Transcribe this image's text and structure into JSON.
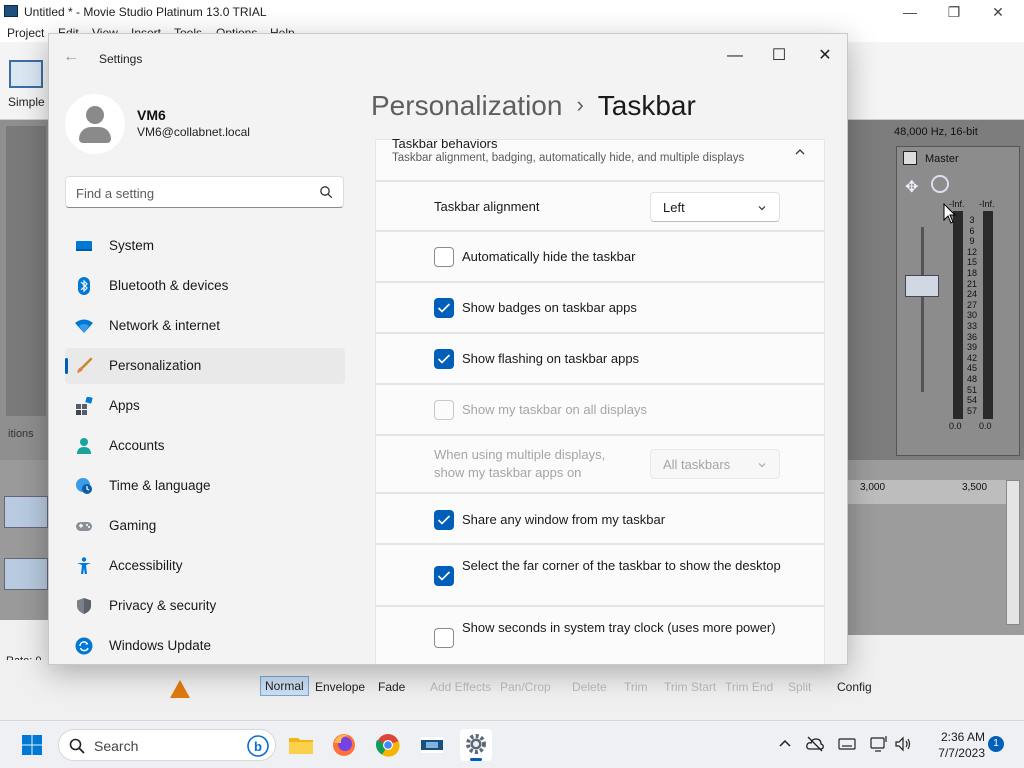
{
  "background_app": {
    "title": "Untitled * - Movie Studio Platinum 13.0 TRIAL",
    "menu": [
      "Project",
      "Edit",
      "View",
      "Insert",
      "Tools",
      "Options",
      "Help"
    ],
    "simple_label": "Simple",
    "left_panel_label": "itions",
    "rate_label": "Rate: 0.",
    "audio_format": "48,000 Hz, 16-bit",
    "master_label": "Master",
    "meter_top_left": "-Inf.",
    "meter_top_right": "-Inf.",
    "meter_scale": [
      "3",
      "6",
      "9",
      "12",
      "15",
      "18",
      "21",
      "24",
      "27",
      "30",
      "33",
      "36",
      "39",
      "42",
      "45",
      "48",
      "51",
      "54",
      "57"
    ],
    "meter_bottom_left": "0.0",
    "meter_bottom_right": "0.0",
    "ruler_ticks": [
      "3,000",
      "3,500"
    ],
    "tools": {
      "normal": "Normal",
      "envelope": "Envelope",
      "fade": "Fade",
      "add_effects": "Add Effects",
      "pan_crop": "Pan/Crop",
      "delete": "Delete",
      "trim": "Trim",
      "trim_start": "Trim Start",
      "trim_end": "Trim End",
      "split": "Split",
      "config": "Config"
    }
  },
  "settings": {
    "window_title": "Settings",
    "profile": {
      "name": "VM6",
      "email": "VM6@collabnet.local"
    },
    "search_placeholder": "Find a setting",
    "nav": [
      {
        "label": "System",
        "icon": "system-icon"
      },
      {
        "label": "Bluetooth & devices",
        "icon": "bluetooth-icon"
      },
      {
        "label": "Network & internet",
        "icon": "wifi-icon"
      },
      {
        "label": "Personalization",
        "icon": "brush-icon",
        "active": true
      },
      {
        "label": "Apps",
        "icon": "apps-icon"
      },
      {
        "label": "Accounts",
        "icon": "person-icon"
      },
      {
        "label": "Time & language",
        "icon": "globe-clock-icon"
      },
      {
        "label": "Gaming",
        "icon": "gamepad-icon"
      },
      {
        "label": "Accessibility",
        "icon": "accessibility-icon"
      },
      {
        "label": "Privacy & security",
        "icon": "shield-icon"
      },
      {
        "label": "Windows Update",
        "icon": "update-icon"
      }
    ],
    "breadcrumb": {
      "parent": "Personalization",
      "separator": "›",
      "current": "Taskbar"
    },
    "taskbar_behaviors": {
      "title": "Taskbar behaviors",
      "subtitle": "Taskbar alignment, badging, automatically hide, and multiple displays",
      "alignment_label": "Taskbar alignment",
      "alignment_value": "Left",
      "auto_hide": {
        "label": "Automatically hide the taskbar",
        "checked": false
      },
      "badges": {
        "label": "Show badges on taskbar apps",
        "checked": true
      },
      "flashing": {
        "label": "Show flashing on taskbar apps",
        "checked": true
      },
      "all_displays": {
        "label": "Show my taskbar on all displays",
        "checked": false,
        "disabled": true
      },
      "multi_display_label_1": "When using multiple displays,",
      "multi_display_label_2": "show my taskbar apps on",
      "multi_display_value": "All taskbars",
      "share_window": {
        "label": "Share any window from my taskbar",
        "checked": true
      },
      "far_corner": {
        "label": "Select the far corner of the taskbar to show the desktop",
        "checked": true
      },
      "seconds": {
        "label": "Show seconds in system tray clock (uses more power)",
        "checked": false
      }
    }
  },
  "taskbar": {
    "search_text": "Search",
    "apps": [
      "file-explorer-icon",
      "firefox-icon",
      "chrome-icon",
      "movie-studio-icon",
      "settings-icon"
    ],
    "time": "2:36 AM",
    "date": "7/7/2023",
    "notification_count": "1"
  },
  "colors": {
    "accent": "#005fb8",
    "window_bg": "#f3f3f3",
    "card_bg": "#fbfbfb"
  }
}
